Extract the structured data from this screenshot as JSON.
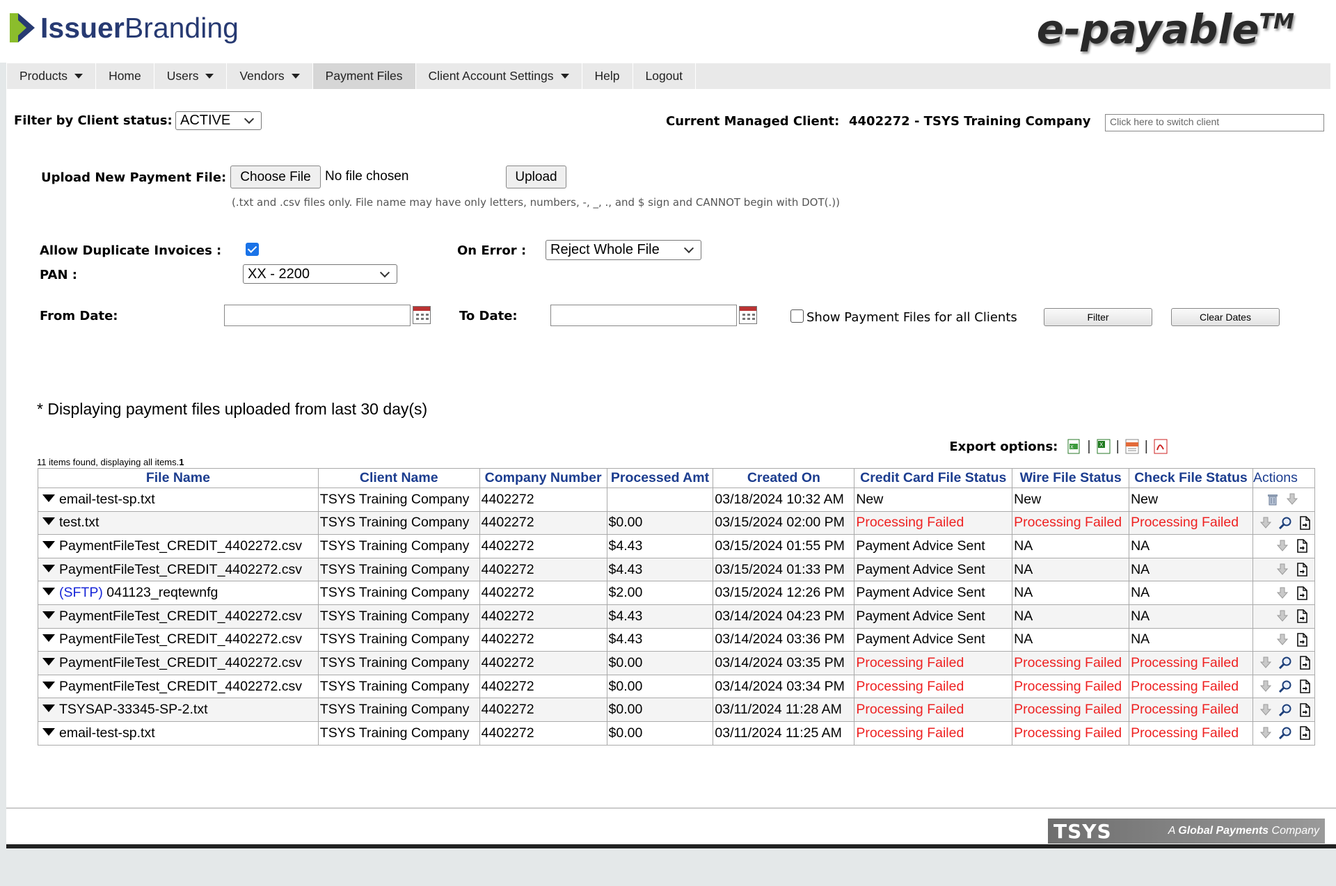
{
  "header": {
    "logo_bold": "Issuer",
    "logo_light": "Branding",
    "brand": "e-payable",
    "brand_tm": "TM"
  },
  "nav": [
    {
      "label": "Products",
      "dropdown": true
    },
    {
      "label": "Home",
      "dropdown": false
    },
    {
      "label": "Users",
      "dropdown": true
    },
    {
      "label": "Vendors",
      "dropdown": true
    },
    {
      "label": "Payment Files",
      "dropdown": false,
      "active": true
    },
    {
      "label": "Client Account Settings",
      "dropdown": true
    },
    {
      "label": "Help",
      "dropdown": false
    },
    {
      "label": "Logout",
      "dropdown": false
    }
  ],
  "filter": {
    "label": "Filter by Client status:",
    "value": "ACTIVE"
  },
  "managed": {
    "label": "Current Managed Client:",
    "value": "4402272 - TSYS Training Company",
    "switch_placeholder": "Click here to switch client"
  },
  "upload": {
    "label": "Upload New Payment File:",
    "choose": "Choose File",
    "no_file": "No file chosen",
    "upload_btn": "Upload",
    "note": "(.txt and .csv files only. File name may have only letters, numbers, -, _, ., and $ sign and CANNOT begin with DOT(.))"
  },
  "options": {
    "dup_label": "Allow Duplicate Invoices :",
    "on_error_label": "On Error :",
    "on_error_value": "Reject Whole File",
    "pan_label": "PAN :",
    "pan_value": "XX - 2200"
  },
  "dates": {
    "from_label": "From Date:",
    "to_label": "To Date:",
    "show_all": "Show Payment Files for all Clients",
    "filter_btn": "Filter",
    "clear_btn": "Clear Dates"
  },
  "caption": "* Displaying payment files uploaded from last 30 day(s)",
  "export_label": "Export options:",
  "count_text": "11 items found, displaying all items.",
  "count_page": "1",
  "columns": [
    "File Name",
    "Client Name",
    "Company Number",
    "Processed Amt",
    "Created On",
    "Credit Card File Status",
    "Wire File Status",
    "Check File Status",
    "Actions"
  ],
  "rows": [
    {
      "prefix": "",
      "file": "email-test-sp.txt",
      "client": "TSYS Training Company",
      "company": "4402272",
      "amt": "",
      "created": "03/18/2024 10:32 AM",
      "cc": "New",
      "wire": "New",
      "check": "New",
      "actions": [
        "trash-icon",
        "download-icon"
      ]
    },
    {
      "prefix": "",
      "file": "test.txt",
      "client": "TSYS Training Company",
      "company": "4402272",
      "amt": "$0.00",
      "created": "03/15/2024 02:00 PM",
      "cc": "Processing Failed",
      "wire": "Processing Failed",
      "check": "Processing Failed",
      "actions": [
        "download-icon",
        "magnifier-icon",
        "document-icon"
      ]
    },
    {
      "prefix": "",
      "file": "PaymentFileTest_CREDIT_4402272.csv",
      "client": "TSYS Training Company",
      "company": "4402272",
      "amt": "$4.43",
      "created": "03/15/2024 01:55 PM",
      "cc": "Payment Advice Sent",
      "wire": "NA",
      "check": "NA",
      "actions": [
        "download-icon",
        "document-icon"
      ]
    },
    {
      "prefix": "",
      "file": "PaymentFileTest_CREDIT_4402272.csv",
      "client": "TSYS Training Company",
      "company": "4402272",
      "amt": "$4.43",
      "created": "03/15/2024 01:33 PM",
      "cc": "Payment Advice Sent",
      "wire": "NA",
      "check": "NA",
      "actions": [
        "download-icon",
        "document-icon"
      ]
    },
    {
      "prefix": "(SFTP)",
      "file": "041123_reqtewnfg",
      "client": "TSYS Training Company",
      "company": "4402272",
      "amt": "$2.00",
      "created": "03/15/2024 12:26 PM",
      "cc": "Payment Advice Sent",
      "wire": "NA",
      "check": "NA",
      "actions": [
        "download-icon",
        "document-icon"
      ]
    },
    {
      "prefix": "",
      "file": "PaymentFileTest_CREDIT_4402272.csv",
      "client": "TSYS Training Company",
      "company": "4402272",
      "amt": "$4.43",
      "created": "03/14/2024 04:23 PM",
      "cc": "Payment Advice Sent",
      "wire": "NA",
      "check": "NA",
      "actions": [
        "download-icon",
        "document-icon"
      ]
    },
    {
      "prefix": "",
      "file": "PaymentFileTest_CREDIT_4402272.csv",
      "client": "TSYS Training Company",
      "company": "4402272",
      "amt": "$4.43",
      "created": "03/14/2024 03:36 PM",
      "cc": "Payment Advice Sent",
      "wire": "NA",
      "check": "NA",
      "actions": [
        "download-icon",
        "document-icon"
      ]
    },
    {
      "prefix": "",
      "file": "PaymentFileTest_CREDIT_4402272.csv",
      "client": "TSYS Training Company",
      "company": "4402272",
      "amt": "$0.00",
      "created": "03/14/2024 03:35 PM",
      "cc": "Processing Failed",
      "wire": "Processing Failed",
      "check": "Processing Failed",
      "actions": [
        "download-icon",
        "magnifier-icon",
        "document-icon"
      ]
    },
    {
      "prefix": "",
      "file": "PaymentFileTest_CREDIT_4402272.csv",
      "client": "TSYS Training Company",
      "company": "4402272",
      "amt": "$0.00",
      "created": "03/14/2024 03:34 PM",
      "cc": "Processing Failed",
      "wire": "Processing Failed",
      "check": "Processing Failed",
      "actions": [
        "download-icon",
        "magnifier-icon",
        "document-icon"
      ]
    },
    {
      "prefix": "",
      "file": "TSYSAP-33345-SP-2.txt",
      "client": "TSYS Training Company",
      "company": "4402272",
      "amt": "$0.00",
      "created": "03/11/2024 11:28 AM",
      "cc": "Processing Failed",
      "wire": "Processing Failed",
      "check": "Processing Failed",
      "actions": [
        "download-icon",
        "magnifier-icon",
        "document-icon"
      ]
    },
    {
      "prefix": "",
      "file": "email-test-sp.txt",
      "client": "TSYS Training Company",
      "company": "4402272",
      "amt": "$0.00",
      "created": "03/11/2024 11:25 AM",
      "cc": "Processing Failed",
      "wire": "Processing Failed",
      "check": "Processing Failed",
      "actions": [
        "download-icon",
        "magnifier-icon",
        "document-icon"
      ]
    }
  ],
  "failed_text": "Processing Failed",
  "footer": {
    "tsys": "TSYS",
    "tagline_a": "A ",
    "tagline_b": "Global Payments",
    "tagline_c": " Company"
  },
  "colors": {
    "nav_bg": "#e9e9e9",
    "header_text": "#1c3d8f",
    "failed": "#e22222",
    "logo_blue": "#273a72",
    "logo_green": "#8bbd2c"
  }
}
